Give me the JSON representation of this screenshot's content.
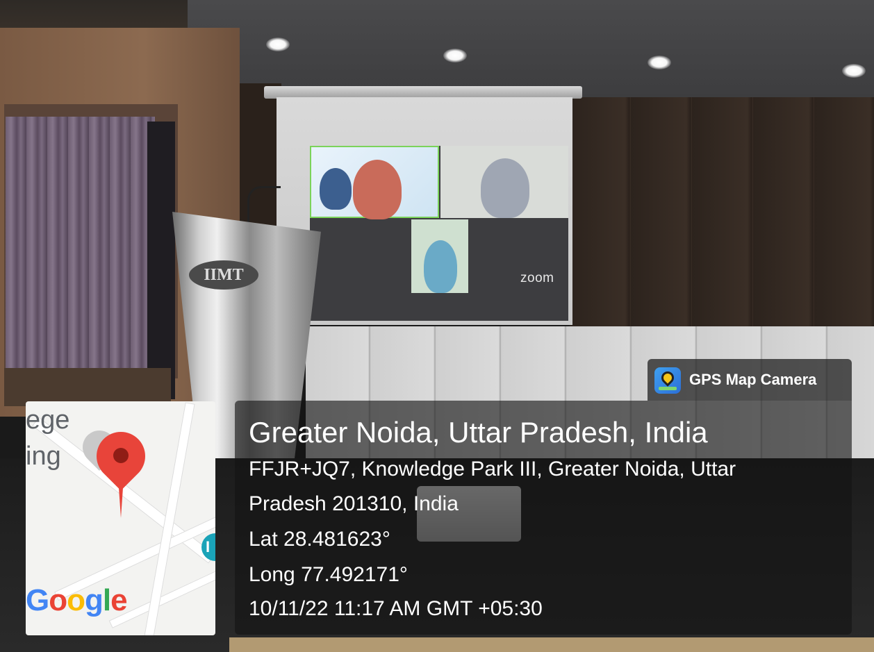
{
  "photo_scene": {
    "podium_logo": "IIMT",
    "screen_app_label": "zoom"
  },
  "gps_badge": {
    "icon": "gps-map-camera-icon",
    "title": "GPS Map Camera"
  },
  "location": {
    "city_line": "Greater Noida, Uttar Pradesh, India",
    "address_line_1": "FFJR+JQ7, Knowledge Park III, Greater Noida, Uttar",
    "address_line_2": "Pradesh 201310, India",
    "latitude": "Lat 28.481623°",
    "longitude": "Long 77.492171°",
    "datetime": "10/11/22 11:17 AM GMT +05:30"
  },
  "map": {
    "label_partial_1": "ege",
    "label_partial_2": "ing",
    "marker_icon": "map-pin-icon",
    "brand": [
      "G",
      "o",
      "o",
      "g",
      "l",
      "e"
    ],
    "colors": {
      "pin": "#e8443a",
      "brand_blue": "#4285f4",
      "brand_red": "#ea4335",
      "brand_yellow": "#fbbc05",
      "brand_green": "#34a853"
    }
  }
}
